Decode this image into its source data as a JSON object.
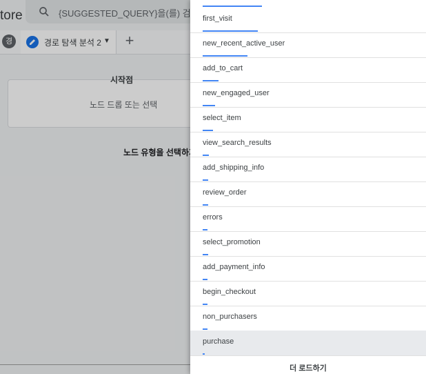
{
  "app": {
    "name_fragment": "tore"
  },
  "search": {
    "placeholder": "{SUGGESTED_QUERY}을(를) 검색하",
    "icon": "search-icon"
  },
  "tabs": {
    "avatar_letter": "경",
    "active_tab_label": "경로 탐색 분석 2",
    "add_tab_symbol": "+"
  },
  "canvas": {
    "startpoint_title": "시작점",
    "startpoint_hint": "노드 드롭 또는 선택",
    "node_type_prompt": "노드 유형을 선택하거"
  },
  "panel": {
    "items": [
      {
        "label": "first_visit",
        "level": 0.16
      },
      {
        "label": "new_recent_active_user",
        "level": 0.13
      },
      {
        "label": "add_to_cart",
        "level": 0.045
      },
      {
        "label": "new_engaged_user",
        "level": 0.035
      },
      {
        "label": "select_item",
        "level": 0.03
      },
      {
        "label": "view_search_results",
        "level": 0.018
      },
      {
        "label": "add_shipping_info",
        "level": 0.016
      },
      {
        "label": "review_order",
        "level": 0.016
      },
      {
        "label": "errors",
        "level": 0.014
      },
      {
        "label": "select_promotion",
        "level": 0.016
      },
      {
        "label": "add_payment_info",
        "level": 0.014
      },
      {
        "label": "begin_checkout",
        "level": 0.014
      },
      {
        "label": "non_purchasers",
        "level": 0.014
      },
      {
        "label": "purchase",
        "level": 0.006,
        "highlighted": true
      }
    ],
    "load_more_label": "더 로드하기"
  },
  "colors": {
    "accent": "#4285f4",
    "tab_icon": "#1a73e8"
  }
}
